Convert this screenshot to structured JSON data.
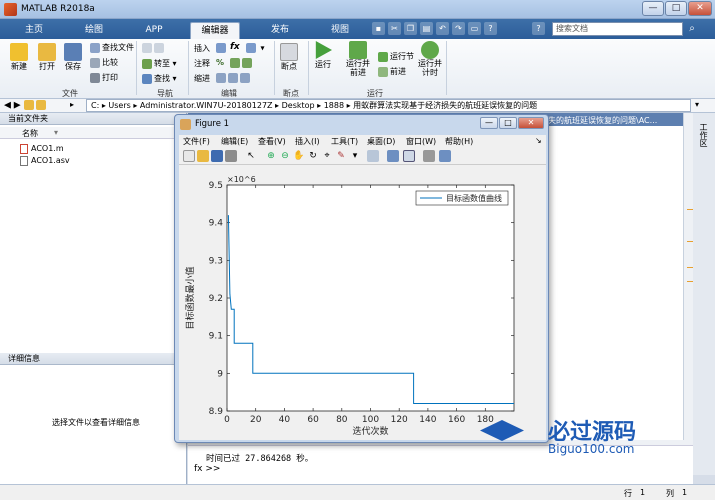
{
  "window": {
    "title": "MATLAB R2018a",
    "min": "—",
    "max": "□",
    "close": "✕"
  },
  "tabs": [
    {
      "label": "主页"
    },
    {
      "label": "绘图"
    },
    {
      "label": "APP"
    },
    {
      "label": "编辑器"
    },
    {
      "label": "发布"
    },
    {
      "label": "视图"
    }
  ],
  "search": {
    "placeholder": "搜索文档"
  },
  "ribbon": {
    "file": {
      "new": "新建",
      "open": "打开",
      "save": "保存",
      "find_files": "查找文件",
      "compare": "比较",
      "print": "打印",
      "section": "文件"
    },
    "nav": {
      "goto": "转至",
      "find": "查找",
      "section": "导航"
    },
    "edit": {
      "insert": "插入",
      "comment": "注释",
      "indent": "缩进",
      "fx": "fx",
      "pct": "%",
      "section": "编辑"
    },
    "breakpoints": {
      "label": "断点",
      "section": "断点"
    },
    "run": {
      "run": "运行",
      "run_advance": "运行并\n前进",
      "run_section": "运行节",
      "advance": "前进",
      "run_time": "运行并\n计时",
      "section": "运行"
    }
  },
  "address": {
    "path": "C: ▸ Users ▸ Administrator.WIN7U-20180127Z ▸ Desktop ▸ 1888 ▸ 用蚁群算法实现基于经济损失的航班延误恢复的问题"
  },
  "editor_tab": {
    "label": "失的航班延误恢复的问题\\AC..."
  },
  "current_folder": {
    "title": "当前文件夹",
    "col_name": "名称",
    "files": [
      {
        "name": "ACO1.m"
      },
      {
        "name": "ACO1.asv"
      }
    ]
  },
  "details": {
    "title": "详细信息",
    "hint": "选择文件以查看详细信息"
  },
  "command": {
    "output": "时间已过 27.864268 秒。",
    "prompt": "fx >>"
  },
  "status": {
    "row_label": "行",
    "row": "1",
    "col_label": "列",
    "col": "1"
  },
  "figure": {
    "title": "Figure 1",
    "menu": [
      "文件(F)",
      "编辑(E)",
      "查看(V)",
      "插入(I)",
      "工具(T)",
      "桌面(D)",
      "窗口(W)",
      "帮助(H)"
    ]
  },
  "chart_data": {
    "type": "line",
    "title": "",
    "xlabel": "迭代次数",
    "ylabel": "目标函数最小值",
    "exponent_label": "×10^6",
    "xlim": [
      0,
      200
    ],
    "ylim": [
      8.9,
      9.5
    ],
    "x_ticks": [
      "0",
      "20",
      "40",
      "60",
      "80",
      "100",
      "120",
      "140",
      "160",
      "180"
    ],
    "y_ticks": [
      "8.9",
      "9",
      "9.1",
      "9.2",
      "9.3",
      "9.4",
      "9.5"
    ],
    "legend": "top-right",
    "series": [
      {
        "name": "目标函数值曲线",
        "color": "#0072bd",
        "x": [
          1,
          2,
          3,
          4,
          5,
          5,
          7,
          7,
          18,
          18,
          130,
          130,
          200
        ],
        "y": [
          9.42,
          9.21,
          9.17,
          9.17,
          9.17,
          9.08,
          9.08,
          9.08,
          9.08,
          9.0,
          9.0,
          8.92,
          8.92
        ]
      }
    ]
  },
  "watermark": {
    "text": "必过源码",
    "url": "Biguo100.com"
  }
}
